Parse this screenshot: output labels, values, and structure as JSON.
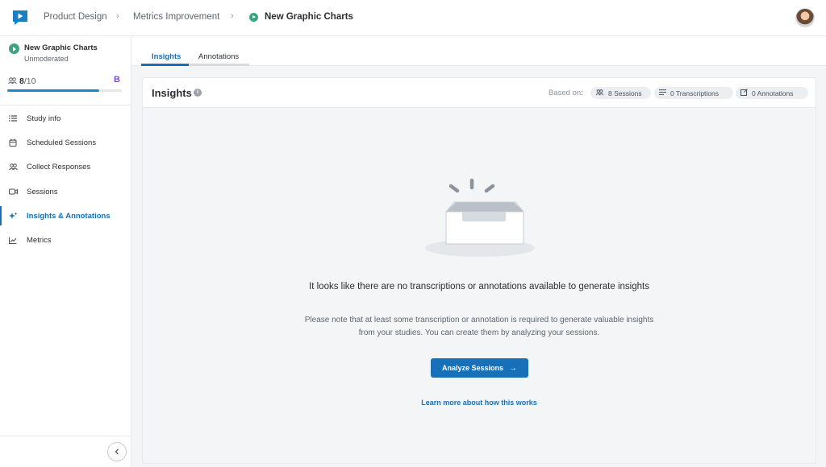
{
  "header": {
    "breadcrumbs": [
      "Product Design",
      "Metrics Improvement",
      "New Graphic Charts"
    ],
    "separator": "›"
  },
  "sidebar": {
    "study_title": "New Graphic Charts",
    "study_type": "Unmoderated",
    "sessions_done": "8",
    "sessions_total": "/10",
    "sessions_progress_fraction": 0.8,
    "plan_badge": "B",
    "items": [
      {
        "label": "Study info",
        "icon": "list-icon"
      },
      {
        "label": "Scheduled Sessions",
        "icon": "calendar-icon"
      },
      {
        "label": "Collect Responses",
        "icon": "participants-icon"
      },
      {
        "label": "Sessions",
        "icon": "video-icon"
      },
      {
        "label": "Insights & Annotations",
        "icon": "sparkle-icon",
        "active": true
      },
      {
        "label": "Metrics",
        "icon": "chart-icon"
      }
    ],
    "collapse_icon": "chevron-left-icon"
  },
  "tabs": [
    {
      "label": "Insights",
      "active": true
    },
    {
      "label": "Annotations",
      "active": false
    }
  ],
  "panel": {
    "title": "Insights",
    "info_icon": "i",
    "based_on_label": "Based on:",
    "chips": [
      {
        "label": "8 Sessions",
        "icon": "participants-icon"
      },
      {
        "label": "0 Transcriptions",
        "icon": "lines-icon"
      },
      {
        "label": "0 Annotations",
        "icon": "note-icon"
      }
    ],
    "empty_title": "It looks like there are no transcriptions or annotations available to generate insights",
    "empty_desc": "Please note that at least some transcription or annotation is required to generate valuable insights from your studies. You can create them by analyzing your sessions.",
    "cta_label": "Analyze Sessions",
    "cta_arrow": "→",
    "learn_link": "Learn more about how this works"
  },
  "colors": {
    "accent": "#1b6fb5",
    "cta": "#1870b8",
    "status_green": "#3aa57c",
    "plan_purple": "#7a4ed6"
  }
}
